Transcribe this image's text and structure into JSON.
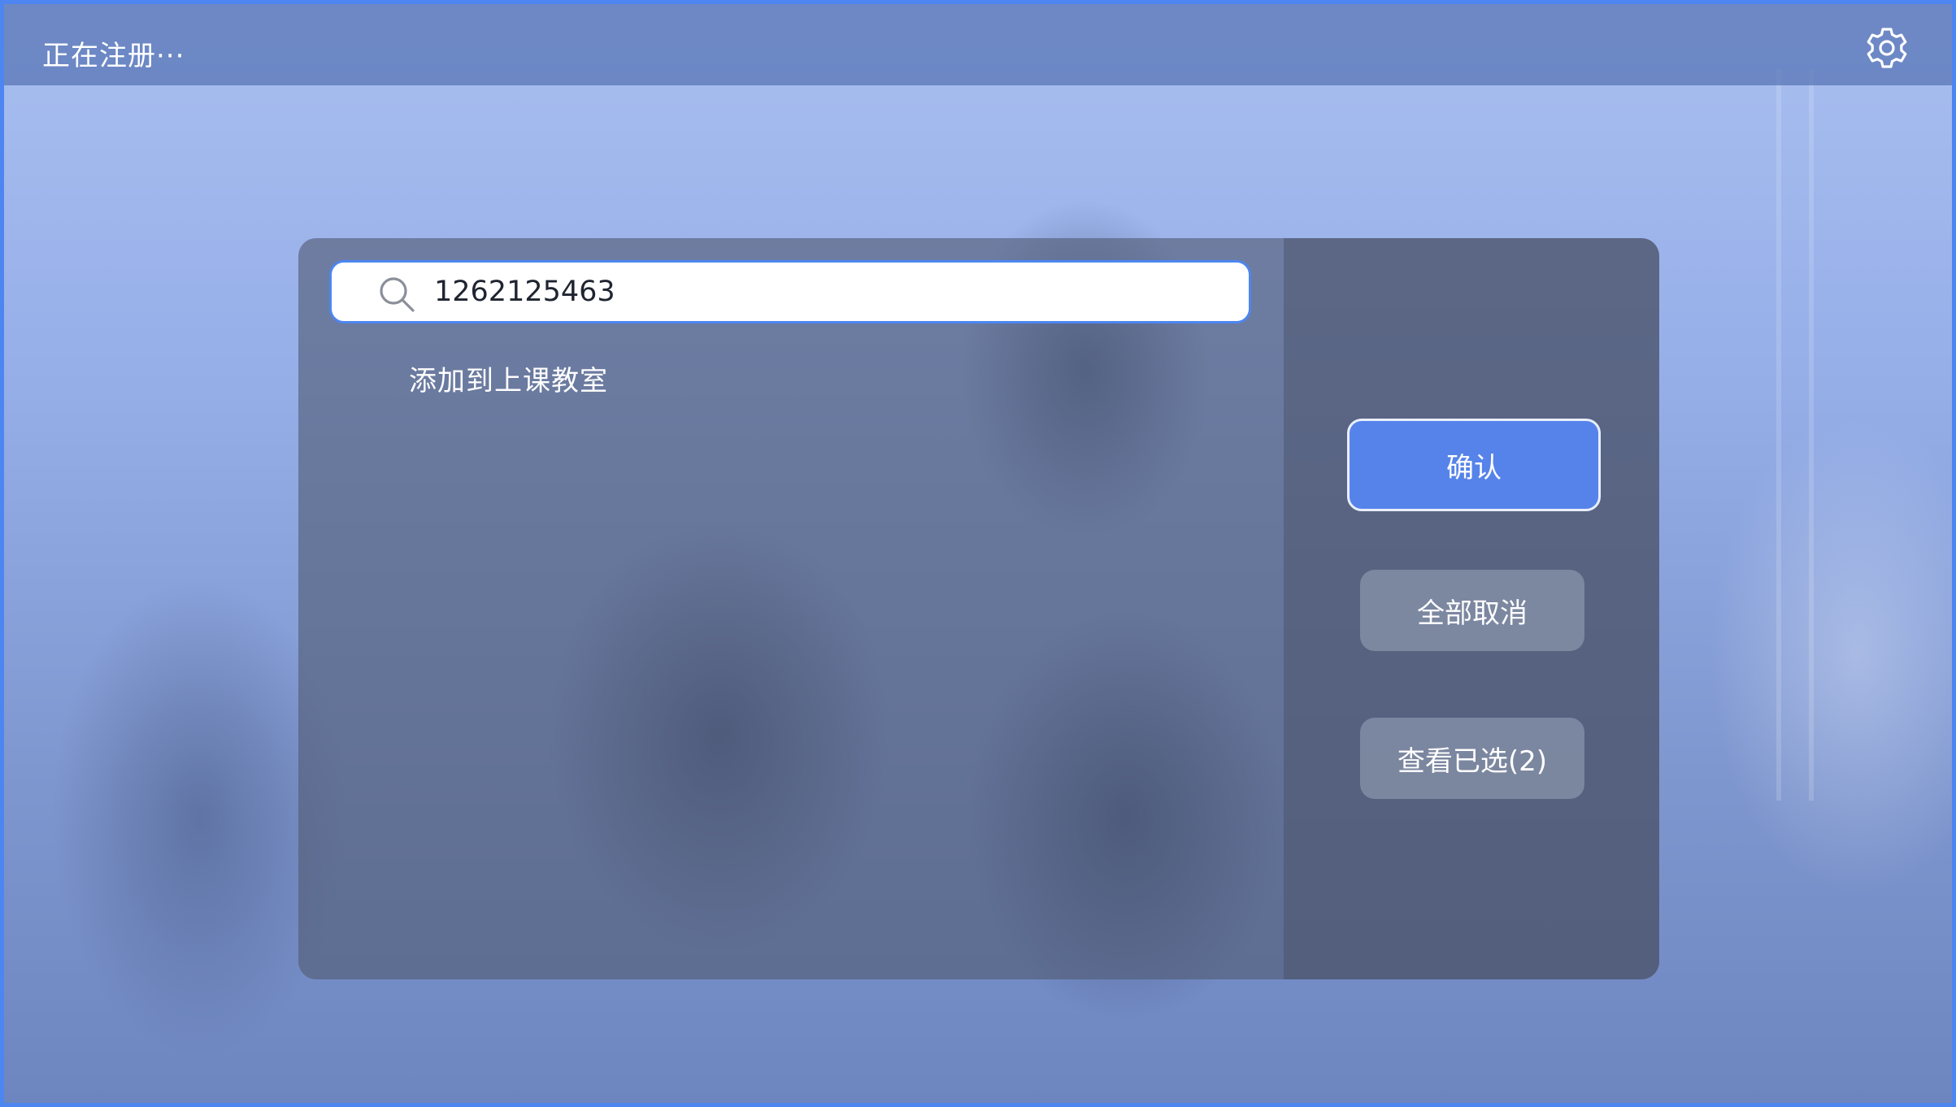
{
  "topbar": {
    "status": "正在注册···",
    "settings_icon": "gear-icon"
  },
  "search": {
    "value": "1262125463",
    "icon": "search-icon"
  },
  "panel": {
    "add_label": "添加到上课教室"
  },
  "actions": {
    "confirm_label": "确认",
    "cancel_all_label": "全部取消",
    "view_selected_label": "查看已选(2)"
  },
  "colors": {
    "accent": "#4d86f0",
    "confirm_button": "#5683ea"
  }
}
